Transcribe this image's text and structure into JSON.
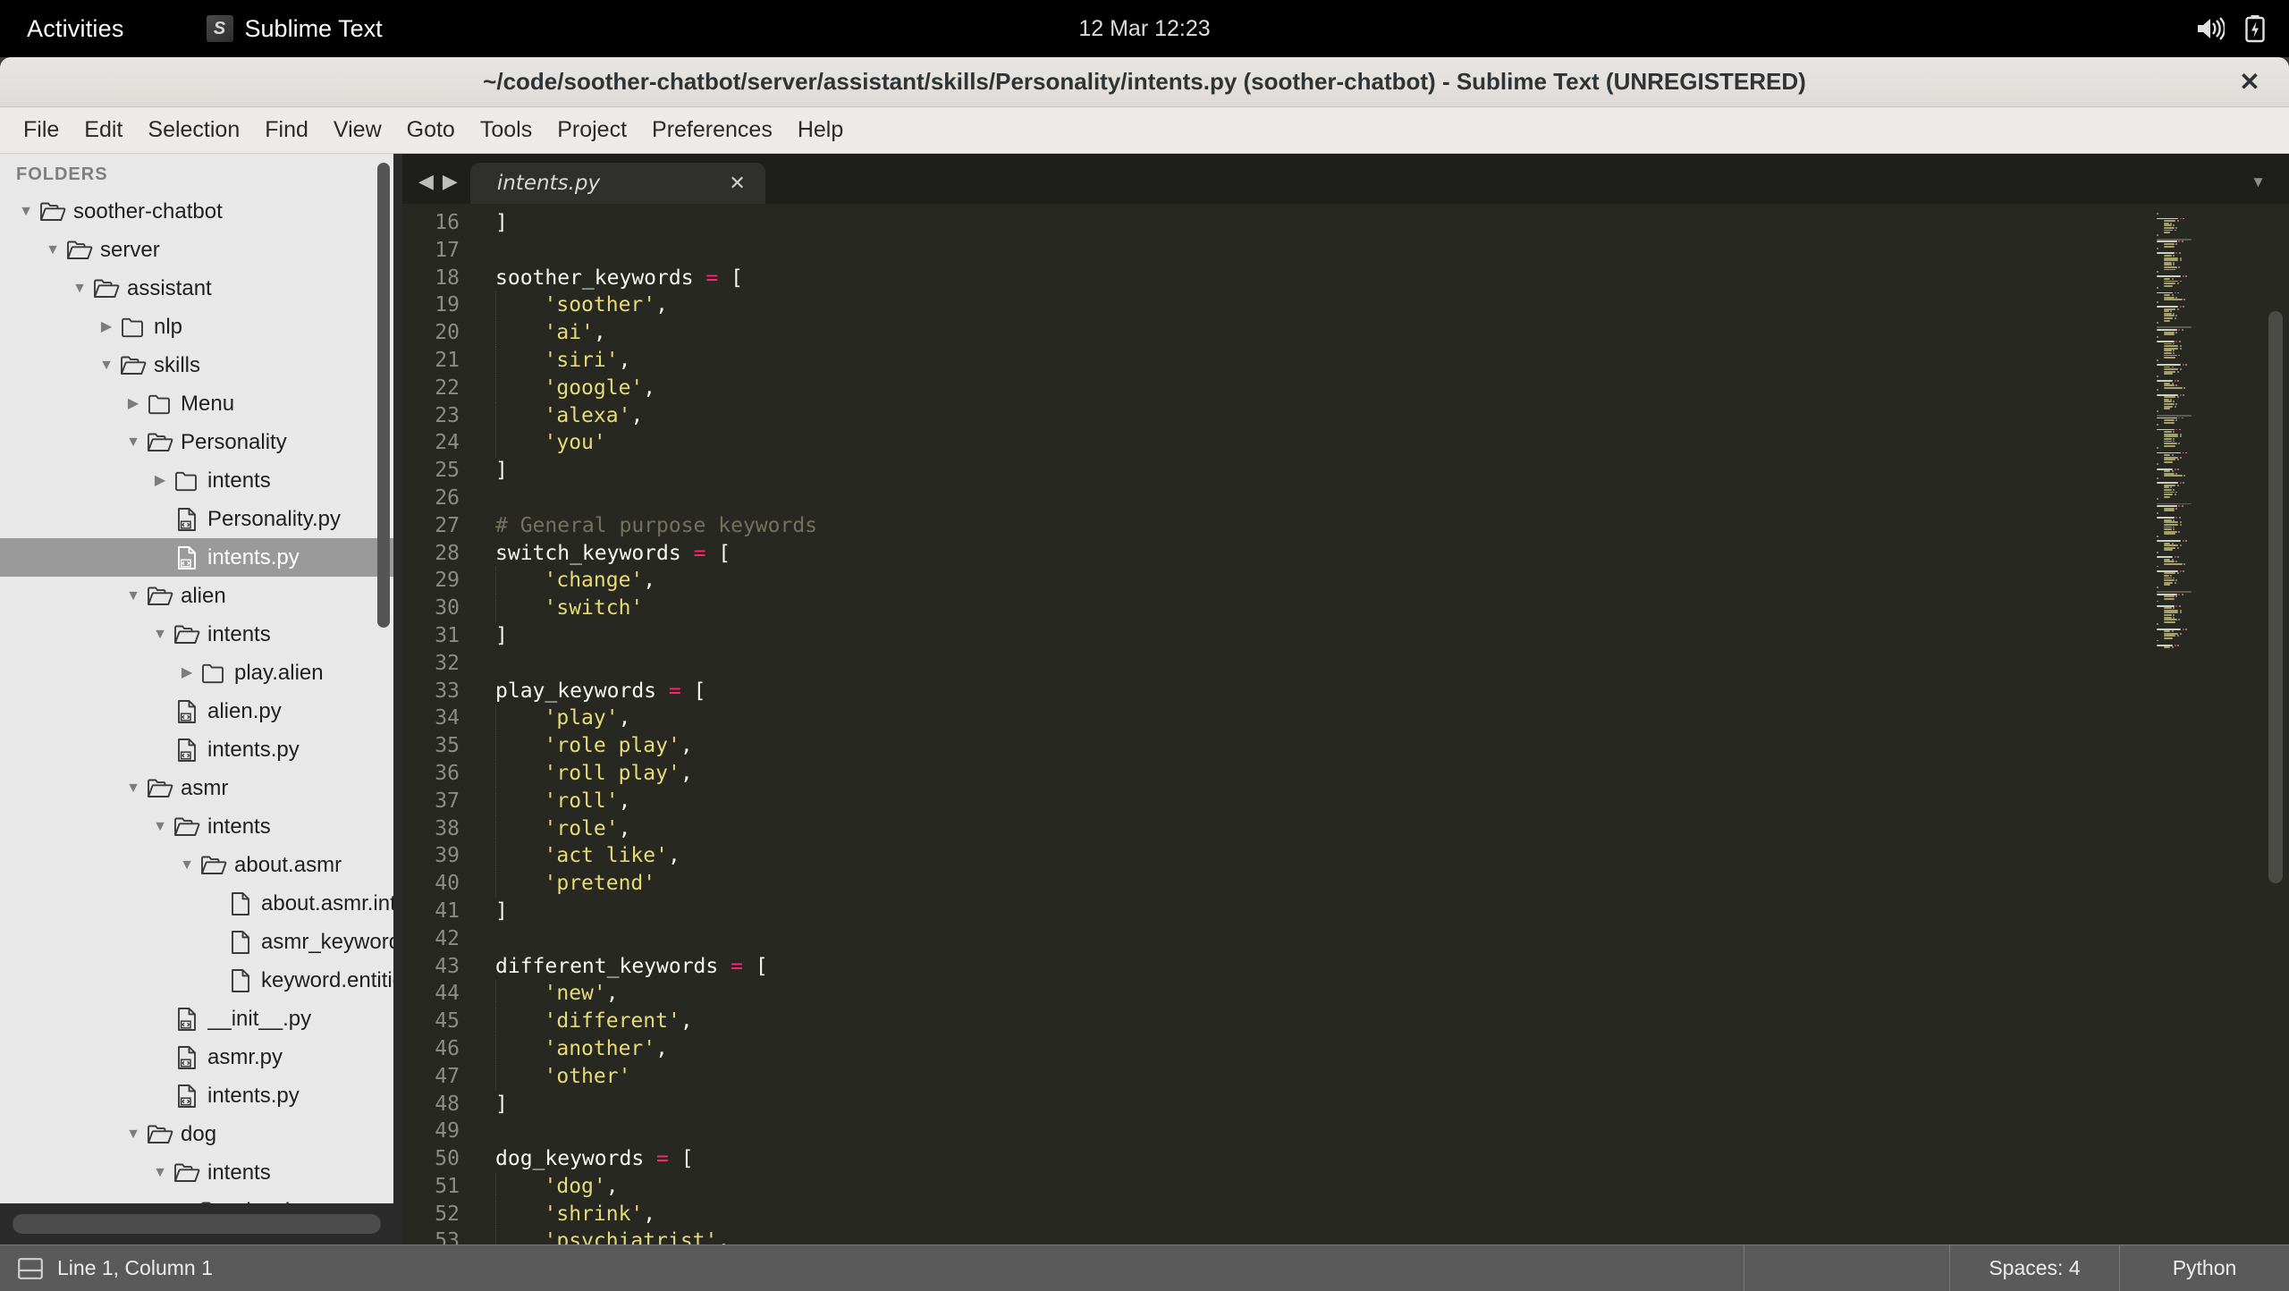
{
  "desktop": {
    "activities_label": "Activities",
    "app_name": "Sublime Text",
    "clock": "12 Mar  12:23",
    "tray_icons": [
      "volume-icon",
      "battery-charging-icon"
    ]
  },
  "window": {
    "title": "~/code/soother-chatbot/server/assistant/skills/Personality/intents.py (soother-chatbot) - Sublime Text (UNREGISTERED)",
    "close_label": "✕"
  },
  "menubar": {
    "items": [
      {
        "label": "File"
      },
      {
        "label": "Edit"
      },
      {
        "label": "Selection"
      },
      {
        "label": "Find"
      },
      {
        "label": "View"
      },
      {
        "label": "Goto"
      },
      {
        "label": "Tools"
      },
      {
        "label": "Project"
      },
      {
        "label": "Preferences"
      },
      {
        "label": "Help"
      }
    ]
  },
  "sidebar": {
    "header": "FOLDERS",
    "tree": [
      {
        "label": "soother-chatbot",
        "depth": 0,
        "type": "folder",
        "state": "open",
        "selected": false
      },
      {
        "label": "server",
        "depth": 1,
        "type": "folder",
        "state": "open",
        "selected": false
      },
      {
        "label": "assistant",
        "depth": 2,
        "type": "folder",
        "state": "open",
        "selected": false
      },
      {
        "label": "nlp",
        "depth": 3,
        "type": "folder",
        "state": "closed",
        "selected": false
      },
      {
        "label": "skills",
        "depth": 3,
        "type": "folder",
        "state": "open",
        "selected": false
      },
      {
        "label": "Menu",
        "depth": 4,
        "type": "folder",
        "state": "closed",
        "selected": false
      },
      {
        "label": "Personality",
        "depth": 4,
        "type": "folder",
        "state": "open",
        "selected": false
      },
      {
        "label": "intents",
        "depth": 5,
        "type": "folder",
        "state": "closed",
        "selected": false
      },
      {
        "label": "Personality.py",
        "depth": 5,
        "type": "file-code",
        "state": "none",
        "selected": false
      },
      {
        "label": "intents.py",
        "depth": 5,
        "type": "file-code",
        "state": "none",
        "selected": true
      },
      {
        "label": "alien",
        "depth": 4,
        "type": "folder",
        "state": "open",
        "selected": false
      },
      {
        "label": "intents",
        "depth": 5,
        "type": "folder",
        "state": "open",
        "selected": false
      },
      {
        "label": "play.alien",
        "depth": 6,
        "type": "folder",
        "state": "closed",
        "selected": false
      },
      {
        "label": "alien.py",
        "depth": 5,
        "type": "file-code",
        "state": "none",
        "selected": false
      },
      {
        "label": "intents.py",
        "depth": 5,
        "type": "file-code",
        "state": "none",
        "selected": false
      },
      {
        "label": "asmr",
        "depth": 4,
        "type": "folder",
        "state": "open",
        "selected": false
      },
      {
        "label": "intents",
        "depth": 5,
        "type": "folder",
        "state": "open",
        "selected": false
      },
      {
        "label": "about.asmr",
        "depth": 6,
        "type": "folder",
        "state": "open",
        "selected": false
      },
      {
        "label": "about.asmr.intents",
        "depth": 7,
        "type": "file-plain",
        "state": "none",
        "selected": false
      },
      {
        "label": "asmr_keyword.entities",
        "depth": 7,
        "type": "file-plain",
        "state": "none",
        "selected": false
      },
      {
        "label": "keyword.entities",
        "depth": 7,
        "type": "file-plain",
        "state": "none",
        "selected": false
      },
      {
        "label": "__init__.py",
        "depth": 5,
        "type": "file-code",
        "state": "none",
        "selected": false
      },
      {
        "label": "asmr.py",
        "depth": 5,
        "type": "file-code",
        "state": "none",
        "selected": false
      },
      {
        "label": "intents.py",
        "depth": 5,
        "type": "file-code",
        "state": "none",
        "selected": false
      },
      {
        "label": "dog",
        "depth": 4,
        "type": "folder",
        "state": "open",
        "selected": false
      },
      {
        "label": "intents",
        "depth": 5,
        "type": "folder",
        "state": "open",
        "selected": false
      },
      {
        "label": "play.dog",
        "depth": 6,
        "type": "folder",
        "state": "open",
        "selected": false
      }
    ]
  },
  "editor": {
    "tabs": [
      {
        "label": "intents.py",
        "active": true,
        "close": "✕"
      }
    ],
    "nav_prev": "◀",
    "nav_next": "▶",
    "tab_menu_arrow": "▼",
    "first_line_number": 16,
    "lines": [
      {
        "n": 16,
        "indent": 0,
        "tokens": [
          {
            "t": "punc",
            "v": "]"
          }
        ]
      },
      {
        "n": 17,
        "indent": 0,
        "tokens": []
      },
      {
        "n": 18,
        "indent": 0,
        "tokens": [
          {
            "t": "var",
            "v": "soother_keywords "
          },
          {
            "t": "op",
            "v": "="
          },
          {
            "t": "punc",
            "v": " ["
          }
        ]
      },
      {
        "n": 19,
        "indent": 1,
        "tokens": [
          {
            "t": "str",
            "v": "'soother'"
          },
          {
            "t": "punc",
            "v": ","
          }
        ]
      },
      {
        "n": 20,
        "indent": 1,
        "tokens": [
          {
            "t": "str",
            "v": "'ai'"
          },
          {
            "t": "punc",
            "v": ","
          }
        ]
      },
      {
        "n": 21,
        "indent": 1,
        "tokens": [
          {
            "t": "str",
            "v": "'siri'"
          },
          {
            "t": "punc",
            "v": ","
          }
        ]
      },
      {
        "n": 22,
        "indent": 1,
        "tokens": [
          {
            "t": "str",
            "v": "'google'"
          },
          {
            "t": "punc",
            "v": ","
          }
        ]
      },
      {
        "n": 23,
        "indent": 1,
        "tokens": [
          {
            "t": "str",
            "v": "'alexa'"
          },
          {
            "t": "punc",
            "v": ","
          }
        ]
      },
      {
        "n": 24,
        "indent": 1,
        "tokens": [
          {
            "t": "str",
            "v": "'you'"
          }
        ]
      },
      {
        "n": 25,
        "indent": 0,
        "tokens": [
          {
            "t": "punc",
            "v": "]"
          }
        ]
      },
      {
        "n": 26,
        "indent": 0,
        "tokens": []
      },
      {
        "n": 27,
        "indent": 0,
        "tokens": [
          {
            "t": "com",
            "v": "# General purpose keywords"
          }
        ]
      },
      {
        "n": 28,
        "indent": 0,
        "tokens": [
          {
            "t": "var",
            "v": "switch_keywords "
          },
          {
            "t": "op",
            "v": "="
          },
          {
            "t": "punc",
            "v": " ["
          }
        ]
      },
      {
        "n": 29,
        "indent": 1,
        "tokens": [
          {
            "t": "str",
            "v": "'change'"
          },
          {
            "t": "punc",
            "v": ","
          }
        ]
      },
      {
        "n": 30,
        "indent": 1,
        "tokens": [
          {
            "t": "str",
            "v": "'switch'"
          }
        ]
      },
      {
        "n": 31,
        "indent": 0,
        "tokens": [
          {
            "t": "punc",
            "v": "]"
          }
        ]
      },
      {
        "n": 32,
        "indent": 0,
        "tokens": []
      },
      {
        "n": 33,
        "indent": 0,
        "tokens": [
          {
            "t": "var",
            "v": "play_keywords "
          },
          {
            "t": "op",
            "v": "="
          },
          {
            "t": "punc",
            "v": " ["
          }
        ]
      },
      {
        "n": 34,
        "indent": 1,
        "tokens": [
          {
            "t": "str",
            "v": "'play'"
          },
          {
            "t": "punc",
            "v": ","
          }
        ]
      },
      {
        "n": 35,
        "indent": 1,
        "tokens": [
          {
            "t": "str",
            "v": "'role play'"
          },
          {
            "t": "punc",
            "v": ","
          }
        ]
      },
      {
        "n": 36,
        "indent": 1,
        "tokens": [
          {
            "t": "str",
            "v": "'roll play'"
          },
          {
            "t": "punc",
            "v": ","
          }
        ]
      },
      {
        "n": 37,
        "indent": 1,
        "tokens": [
          {
            "t": "str",
            "v": "'roll'"
          },
          {
            "t": "punc",
            "v": ","
          }
        ]
      },
      {
        "n": 38,
        "indent": 1,
        "tokens": [
          {
            "t": "str",
            "v": "'role'"
          },
          {
            "t": "punc",
            "v": ","
          }
        ]
      },
      {
        "n": 39,
        "indent": 1,
        "tokens": [
          {
            "t": "str",
            "v": "'act like'"
          },
          {
            "t": "punc",
            "v": ","
          }
        ]
      },
      {
        "n": 40,
        "indent": 1,
        "tokens": [
          {
            "t": "str",
            "v": "'pretend'"
          }
        ]
      },
      {
        "n": 41,
        "indent": 0,
        "tokens": [
          {
            "t": "punc",
            "v": "]"
          }
        ]
      },
      {
        "n": 42,
        "indent": 0,
        "tokens": []
      },
      {
        "n": 43,
        "indent": 0,
        "tokens": [
          {
            "t": "var",
            "v": "different_keywords "
          },
          {
            "t": "op",
            "v": "="
          },
          {
            "t": "punc",
            "v": " ["
          }
        ]
      },
      {
        "n": 44,
        "indent": 1,
        "tokens": [
          {
            "t": "str",
            "v": "'new'"
          },
          {
            "t": "punc",
            "v": ","
          }
        ]
      },
      {
        "n": 45,
        "indent": 1,
        "tokens": [
          {
            "t": "str",
            "v": "'different'"
          },
          {
            "t": "punc",
            "v": ","
          }
        ]
      },
      {
        "n": 46,
        "indent": 1,
        "tokens": [
          {
            "t": "str",
            "v": "'another'"
          },
          {
            "t": "punc",
            "v": ","
          }
        ]
      },
      {
        "n": 47,
        "indent": 1,
        "tokens": [
          {
            "t": "str",
            "v": "'other'"
          }
        ]
      },
      {
        "n": 48,
        "indent": 0,
        "tokens": [
          {
            "t": "punc",
            "v": "]"
          }
        ]
      },
      {
        "n": 49,
        "indent": 0,
        "tokens": []
      },
      {
        "n": 50,
        "indent": 0,
        "tokens": [
          {
            "t": "var",
            "v": "dog_keywords "
          },
          {
            "t": "op",
            "v": "="
          },
          {
            "t": "punc",
            "v": " ["
          }
        ]
      },
      {
        "n": 51,
        "indent": 1,
        "tokens": [
          {
            "t": "str",
            "v": "'dog'"
          },
          {
            "t": "punc",
            "v": ","
          }
        ]
      },
      {
        "n": 52,
        "indent": 1,
        "tokens": [
          {
            "t": "str",
            "v": "'shrink'"
          },
          {
            "t": "punc",
            "v": ","
          }
        ]
      },
      {
        "n": 53,
        "indent": 1,
        "tokens": [
          {
            "t": "str",
            "v": "'psychiatrist'"
          },
          {
            "t": "punc",
            "v": ","
          }
        ]
      }
    ]
  },
  "statusbar": {
    "position": "Line 1, Column 1",
    "indentation": "Spaces: 4",
    "syntax": "Python"
  },
  "colors": {
    "editor_bg": "#272822",
    "string": "#e6db74",
    "operator": "#f92672",
    "comment": "#75715e",
    "text": "#f8f8f2",
    "gutter": "#8c8c84",
    "sidebar_bg": "#e8e8e8",
    "selection_bg": "#9a9a9a",
    "statusbar_bg": "#5a5a5a"
  }
}
